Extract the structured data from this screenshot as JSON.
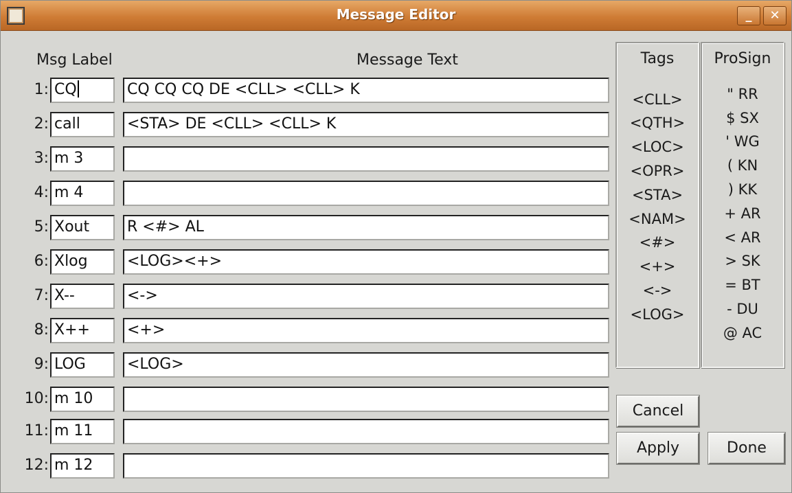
{
  "window": {
    "title": "Message Editor"
  },
  "headers": {
    "msg_label": "Msg Label",
    "message_text": "Message Text"
  },
  "rows": [
    {
      "num": "1:",
      "label": "CQ",
      "text": "CQ CQ CQ DE <CLL> <CLL> K"
    },
    {
      "num": "2:",
      "label": "call",
      "text": "<STA> DE <CLL> <CLL> K"
    },
    {
      "num": "3:",
      "label": "m 3",
      "text": ""
    },
    {
      "num": "4:",
      "label": "m 4",
      "text": ""
    },
    {
      "num": "5:",
      "label": "Xout",
      "text": "R <#> AL"
    },
    {
      "num": "6:",
      "label": "Xlog",
      "text": "<LOG><+>"
    },
    {
      "num": "7:",
      "label": "X--",
      "text": "<->"
    },
    {
      "num": "8:",
      "label": "X++",
      "text": "<+>"
    },
    {
      "num": "9:",
      "label": "LOG",
      "text": "<LOG>"
    },
    {
      "num": "10:",
      "label": "m 10",
      "text": ""
    },
    {
      "num": "11:",
      "label": "m 11",
      "text": ""
    },
    {
      "num": "12:",
      "label": "m 12",
      "text": ""
    }
  ],
  "tags": {
    "title": "Tags",
    "items": [
      "<CLL>",
      "<QTH>",
      "<LOC>",
      "<OPR>",
      "<STA>",
      "<NAM>",
      "<#>",
      "<+>",
      "<->",
      "<LOG>"
    ]
  },
  "prosign": {
    "title": "ProSign",
    "items": [
      "\" RR",
      "$ SX",
      "' WG",
      "( KN",
      ") KK",
      "+ AR",
      "< AR",
      "> SK",
      "= BT",
      "- DU",
      "@ AC"
    ]
  },
  "buttons": {
    "cancel": "Cancel",
    "apply": "Apply",
    "done": "Done"
  },
  "icons": {
    "window": "app-window-icon",
    "minimize": "minimize-icon",
    "close": "close-icon"
  },
  "colors": {
    "titlebar": "#cf7c35",
    "window_bg": "#d7d7d3",
    "field_bg": "#ffffff"
  }
}
